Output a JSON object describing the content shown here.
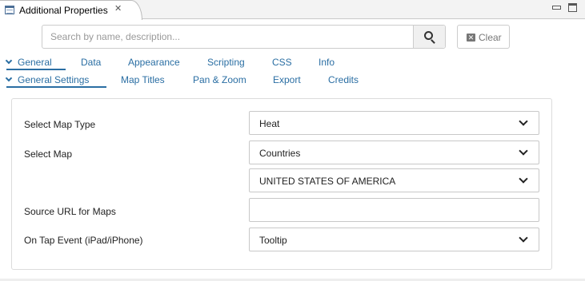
{
  "view": {
    "title": "Additional Properties",
    "close_glyph": "✕"
  },
  "search": {
    "placeholder": "Search by name, description...",
    "value": "",
    "button_icon": "search-icon"
  },
  "clear_button": {
    "icon": "clear-icon",
    "label": "Clear"
  },
  "main_tabs": [
    {
      "label": "General",
      "active": true
    },
    {
      "label": "Data"
    },
    {
      "label": "Appearance"
    },
    {
      "label": "Scripting"
    },
    {
      "label": "CSS"
    },
    {
      "label": "Info"
    }
  ],
  "sub_tabs": [
    {
      "label": "General Settings",
      "active": true
    },
    {
      "label": "Map Titles"
    },
    {
      "label": "Pan & Zoom"
    },
    {
      "label": "Export"
    },
    {
      "label": "Credits"
    }
  ],
  "form": {
    "map_type": {
      "label": "Select Map Type",
      "value": "Heat"
    },
    "map": {
      "label": "Select Map",
      "value": "Countries"
    },
    "country": {
      "value": "UNITED STATES OF AMERICA"
    },
    "source_url": {
      "label": "Source URL for Maps",
      "value": ""
    },
    "tap_event": {
      "label": "On Tap Event (iPad/iPhone)",
      "value": "Tooltip"
    }
  },
  "colors": {
    "accent": "#2a6ea3",
    "border": "#c8c8c8"
  }
}
